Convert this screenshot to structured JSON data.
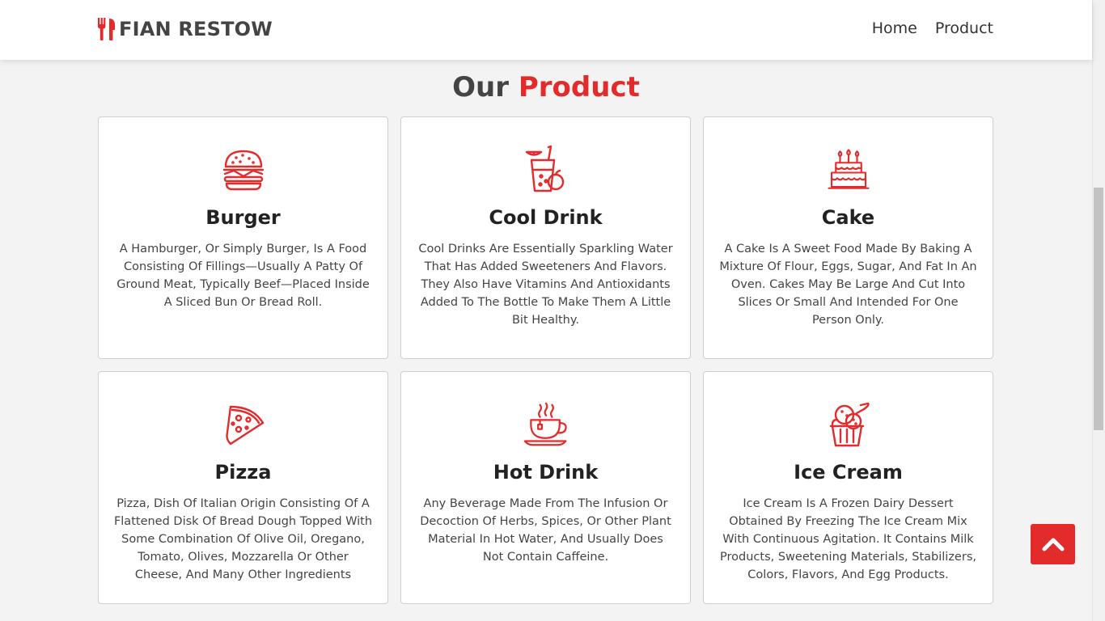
{
  "brand": {
    "name": "FIAN RESTOW",
    "icon": "fork-knife-icon"
  },
  "nav": {
    "items": [
      "Home",
      "Product"
    ]
  },
  "section": {
    "title_prefix": "Our",
    "title_accent": "Product"
  },
  "products": [
    {
      "title": "Burger",
      "icon": "burger-icon",
      "description": "A Hamburger, Or Simply Burger, Is A Food Consisting Of Fillings—Usually A Patty Of Ground Meat, Typically Beef—Placed Inside A Sliced Bun Or Bread Roll."
    },
    {
      "title": "Cool Drink",
      "icon": "cool-drink-icon",
      "description": "Cool Drinks Are Essentially Sparkling Water That Has Added Sweeteners And Flavors. They Also Have Vitamins And Antioxidants Added To The Bottle To Make Them A Little Bit Healthy."
    },
    {
      "title": "Cake",
      "icon": "cake-icon",
      "description": "A Cake Is A Sweet Food Made By Baking A Mixture Of Flour, Eggs, Sugar, And Fat In An Oven. Cakes May Be Large And Cut Into Slices Or Small And Intended For One Person Only."
    },
    {
      "title": "Pizza",
      "icon": "pizza-icon",
      "description": "Pizza, Dish Of Italian Origin Consisting Of A Flattened Disk Of Bread Dough Topped With Some Combination Of Olive Oil, Oregano, Tomato, Olives, Mozzarella Or Other Cheese, And Many Other Ingredients"
    },
    {
      "title": "Hot Drink",
      "icon": "hot-drink-icon",
      "description": "Any Beverage Made From The Infusion Or Decoction Of Herbs, Spices, Or Other Plant Material In Hot Water, And Usually Does Not Contain Caffeine."
    },
    {
      "title": "Ice Cream",
      "icon": "ice-cream-icon",
      "description": "Ice Cream Is A Frozen Dairy Dessert Obtained By Freezing The Ice Cream Mix With Continuous Agitation. It Contains Milk Products, Sweetening Materials, Stabilizers, Colors, Flavors, And Egg Products."
    }
  ],
  "scroll_top": {
    "icon": "chevron-up-icon"
  },
  "colors": {
    "accent": "#e32b2b",
    "heading": "#444444",
    "background": "#f3f3f3"
  }
}
